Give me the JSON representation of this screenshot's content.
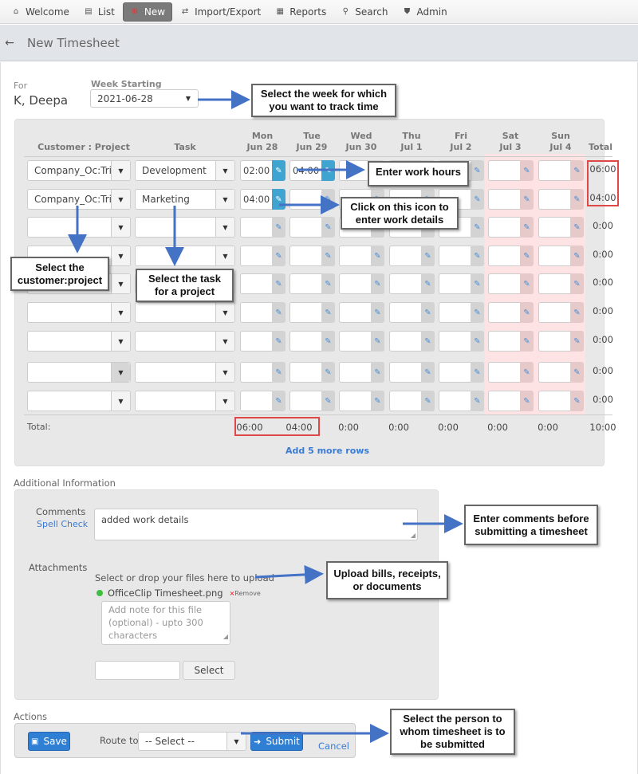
{
  "nav": {
    "items": [
      {
        "label": "Welcome",
        "icon": "home-icon",
        "glyph": "⌂"
      },
      {
        "label": "List",
        "icon": "document-icon",
        "glyph": "▤"
      },
      {
        "label": "New",
        "icon": "plus-circle-icon",
        "glyph": "⊕",
        "active": true
      },
      {
        "label": "Import/Export",
        "icon": "swap-arrows-icon",
        "glyph": "⇄"
      },
      {
        "label": "Reports",
        "icon": "chart-icon",
        "glyph": "▦"
      },
      {
        "label": "Search",
        "icon": "search-icon",
        "glyph": "⚲"
      },
      {
        "label": "Admin",
        "icon": "shield-icon",
        "glyph": "⛊"
      }
    ]
  },
  "header": {
    "back_glyph": "←",
    "title": "New Timesheet"
  },
  "form": {
    "for_label": "For",
    "for_name": "K, Deepa",
    "week_label": "Week Starting",
    "week_value": "2021-06-28"
  },
  "grid": {
    "col_customer": "Customer : Project",
    "col_task": "Task",
    "col_total": "Total",
    "days": [
      {
        "dow": "Mon",
        "date": "Jun 28"
      },
      {
        "dow": "Tue",
        "date": "Jun 29"
      },
      {
        "dow": "Wed",
        "date": "Jun 30"
      },
      {
        "dow": "Thu",
        "date": "Jul 1"
      },
      {
        "dow": "Fri",
        "date": "Jul 2"
      },
      {
        "dow": "Sat",
        "date": "Jul 3"
      },
      {
        "dow": "Sun",
        "date": "Jul 4"
      }
    ],
    "rows": [
      {
        "customer": "Company_Oc:Trial",
        "task": "Development",
        "hours": [
          "02:00",
          "04:00",
          "",
          "",
          "",
          "",
          ""
        ],
        "total": "06:00"
      },
      {
        "customer": "Company_Oc:Trial",
        "task": "Marketing",
        "hours": [
          "04:00",
          "",
          "",
          "",
          "",
          "",
          ""
        ],
        "total": "04:00"
      },
      {
        "customer": "",
        "task": "",
        "hours": [
          "",
          "",
          "",
          "",
          "",
          "",
          ""
        ],
        "total": "0:00"
      },
      {
        "customer": "",
        "task": "",
        "hours": [
          "",
          "",
          "",
          "",
          "",
          "",
          ""
        ],
        "total": "0:00"
      },
      {
        "customer": "",
        "task": "",
        "hours": [
          "",
          "",
          "",
          "",
          "",
          "",
          ""
        ],
        "total": "0:00"
      },
      {
        "customer": "",
        "task": "",
        "hours": [
          "",
          "",
          "",
          "",
          "",
          "",
          ""
        ],
        "total": "0:00"
      },
      {
        "customer": "",
        "task": "",
        "hours": [
          "",
          "",
          "",
          "",
          "",
          "",
          ""
        ],
        "total": "0:00"
      },
      {
        "customer": "",
        "task": "",
        "hours": [
          "",
          "",
          "",
          "",
          "",
          "",
          ""
        ],
        "total": "0:00"
      },
      {
        "customer": "",
        "task": "",
        "hours": [
          "",
          "",
          "",
          "",
          "",
          "",
          ""
        ],
        "total": "0:00"
      }
    ],
    "total_label": "Total:",
    "day_totals": [
      "06:00",
      "04:00",
      "0:00",
      "0:00",
      "0:00",
      "0:00",
      "0:00"
    ],
    "grand_total": "10:00",
    "add_rows_label": "Add 5 more rows"
  },
  "additional": {
    "section_label": "Additional Information",
    "comments_label": "Comments",
    "spell_check_label": "Spell Check",
    "comments_value": "added work details",
    "attachments_label": "Attachments",
    "drop_hint": "Select or drop your files here to upload",
    "file_name": "OfficeClip Timesheet.png",
    "remove_label": "Remove",
    "note_placeholder": "Add note for this file (optional) - upto 300 characters",
    "select_button": "Select"
  },
  "actions": {
    "section_label": "Actions",
    "save_label": "Save",
    "route_to_label": "Route to",
    "route_value": "-- Select --",
    "submit_label": "Submit",
    "cancel_label": "Cancel"
  },
  "callouts": {
    "week": "Select the week for which you want to track time",
    "hours": "Enter work hours",
    "icon": "Click on this icon to enter work details",
    "customer": "Select the customer:project",
    "task": "Select the task for a project",
    "comments": "Enter comments before submitting a timesheet",
    "upload": "Upload bills, receipts, or documents",
    "route": "Select the person to whom timesheet is to be submitted"
  },
  "colors": {
    "accent_blue": "#2f7fd4",
    "active_edit_button": "#3fa4cf",
    "weekend_band": "#fde3e3",
    "highlight_red": "#e04848",
    "annotation_arrow": "#4472c4"
  }
}
